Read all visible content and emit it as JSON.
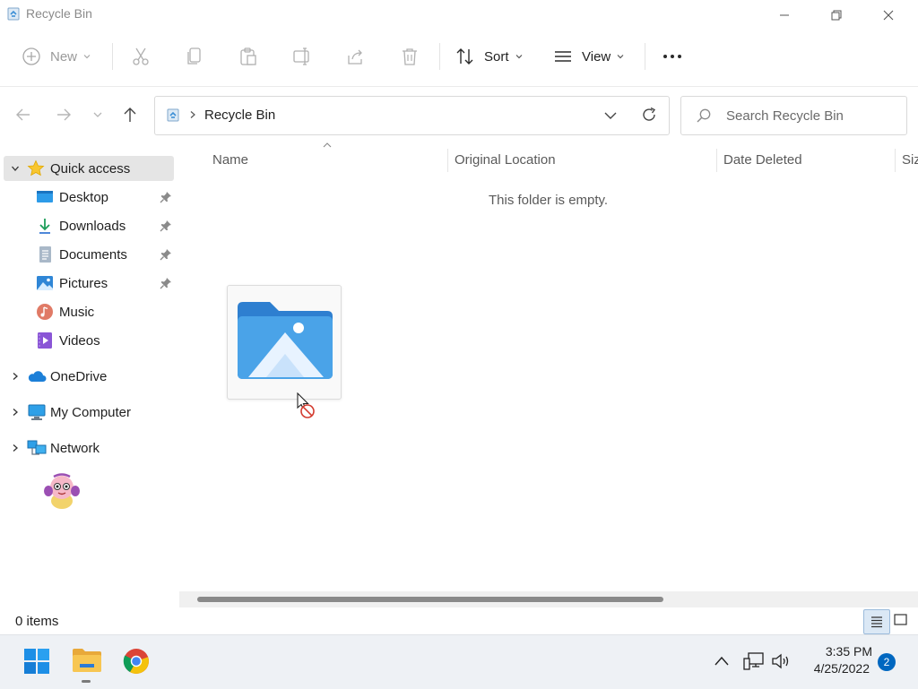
{
  "window": {
    "title": "Recycle Bin"
  },
  "toolbar": {
    "new_label": "New",
    "sort_label": "Sort",
    "view_label": "View"
  },
  "address": {
    "path": "Recycle Bin",
    "search_placeholder": "Search Recycle Bin"
  },
  "nav": {
    "quick_access": "Quick access",
    "items": [
      {
        "label": "Desktop",
        "pinned": true
      },
      {
        "label": "Downloads",
        "pinned": true
      },
      {
        "label": "Documents",
        "pinned": true
      },
      {
        "label": "Pictures",
        "pinned": true
      },
      {
        "label": "Music",
        "pinned": false
      },
      {
        "label": "Videos",
        "pinned": false
      }
    ],
    "onedrive": "OneDrive",
    "my_computer": "My Computer",
    "network": "Network"
  },
  "columns": [
    "Name",
    "Original Location",
    "Date Deleted",
    "Siz"
  ],
  "content": {
    "empty_message": "This folder is empty."
  },
  "status": {
    "items_count": "0 items"
  },
  "taskbar": {
    "time": "3:35 PM",
    "date": "4/25/2022",
    "notification_count": "2"
  },
  "colors": {
    "accent": "#0067c0",
    "folder_blue": "#3c8fd6",
    "selected_bg": "#e5e5e5"
  }
}
